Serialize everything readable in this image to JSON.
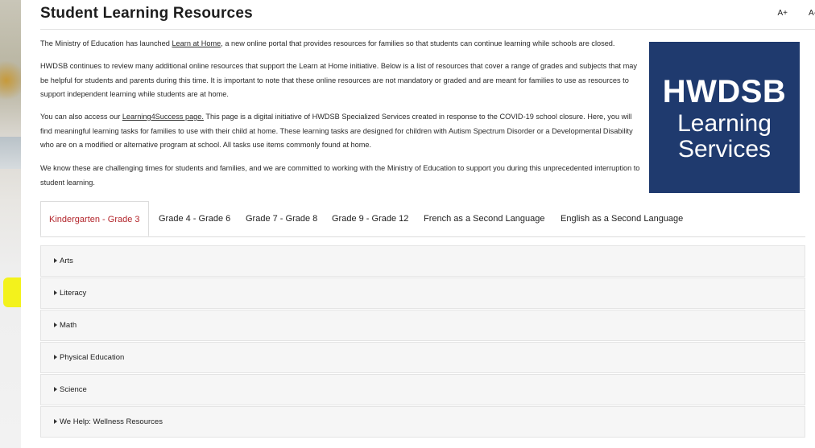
{
  "page": {
    "title": "Student Learning Resources",
    "font_increase": "A+",
    "font_decrease": "A-"
  },
  "intro": {
    "p1_before": "The Ministry of Education has launched ",
    "p1_link": "Learn at Home",
    "p1_after": ", a new online portal that provides resources for families so that students can continue learning while schools are closed.",
    "p2": "HWDSB continues to review many additional online resources that support the Learn at Home initiative. Below is a list of resources that cover a range of grades and subjects that may be helpful for students and parents during this time. It is important to note that these online resources are not mandatory or graded and are meant for families to use as resources to support independent learning while students are at home.",
    "p3_before": "You can also access our ",
    "p3_link": "Learning4Success page.",
    "p3_after": " This page is a digital initiative of HWDSB Specialized Services created in response to the COVID-19 school closure. Here, you will find meaningful learning tasks for families to use with their child at home. These learning tasks are designed for children with Autism Spectrum Disorder or a Developmental Disability who are on a modified or alternative program at school. All tasks use items commonly found at home.",
    "p4": "We know these are challenging times for students and families, and we are committed to working with the Ministry of Education to support you during this unprecedented interruption to student learning."
  },
  "logo": {
    "line1": "HWDSB",
    "line2": "Learning",
    "line3": "Services",
    "bg_color": "#1f3a6e"
  },
  "tabs": [
    {
      "label": "Kindergarten - Grade 3",
      "active": true
    },
    {
      "label": "Grade 4 - Grade 6",
      "active": false
    },
    {
      "label": "Grade 7 - Grade 8",
      "active": false
    },
    {
      "label": "Grade 9 - Grade 12",
      "active": false
    },
    {
      "label": "French as a Second Language",
      "active": false
    },
    {
      "label": "English as a Second Language",
      "active": false
    }
  ],
  "accordion": [
    {
      "label": "Arts"
    },
    {
      "label": "Literacy"
    },
    {
      "label": "Math"
    },
    {
      "label": "Physical Education"
    },
    {
      "label": "Science"
    },
    {
      "label": "We Help: Wellness Resources"
    }
  ],
  "colors": {
    "active_tab": "#b3262c",
    "highlight": "#f3f20a"
  }
}
